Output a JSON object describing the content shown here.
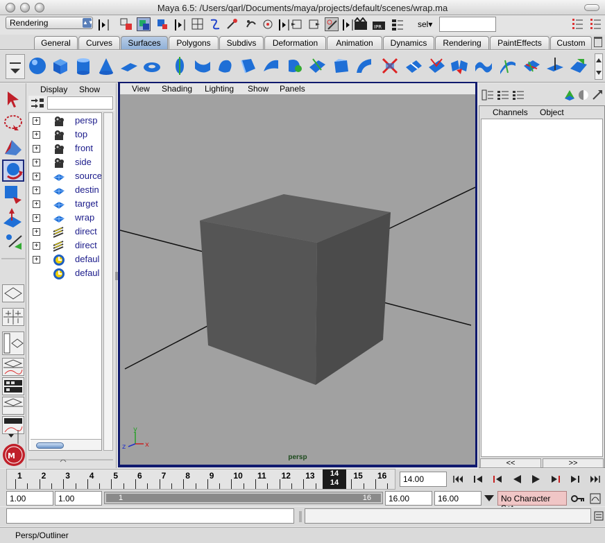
{
  "window": {
    "title": "Maya 6.5: /Users/qarl/Documents/maya/projects/default/scenes/wrap.ma"
  },
  "statusline": {
    "menu_set": "Rendering",
    "selection_label": "sel",
    "selection_value": ""
  },
  "shelf": {
    "tabs": [
      "General",
      "Curves",
      "Surfaces",
      "Polygons",
      "Subdivs",
      "Deformation",
      "Animation",
      "Dynamics",
      "Rendering",
      "PaintEffects",
      "Custom"
    ],
    "active_tab": "Surfaces"
  },
  "outliner": {
    "menu": [
      "Display",
      "Show"
    ],
    "items": [
      {
        "label": "persp",
        "icon": "camera-icon",
        "expandable": true
      },
      {
        "label": "top",
        "icon": "camera-icon",
        "expandable": true
      },
      {
        "label": "front",
        "icon": "camera-icon",
        "expandable": true
      },
      {
        "label": "side",
        "icon": "camera-icon",
        "expandable": true
      },
      {
        "label": "source",
        "icon": "nurbs-surface-icon",
        "expandable": true
      },
      {
        "label": "destin",
        "icon": "nurbs-surface-icon",
        "expandable": true
      },
      {
        "label": "target",
        "icon": "nurbs-surface-icon",
        "expandable": true
      },
      {
        "label": "wrap",
        "icon": "nurbs-surface-icon",
        "expandable": true
      },
      {
        "label": "direct",
        "icon": "directional-light-icon",
        "expandable": true
      },
      {
        "label": "direct",
        "icon": "directional-light-icon",
        "expandable": true
      },
      {
        "label": "defaul",
        "icon": "set-icon",
        "expandable": true
      },
      {
        "label": "defaul",
        "icon": "set-icon",
        "expandable": false
      }
    ]
  },
  "viewport": {
    "menu": [
      "View",
      "Shading",
      "Lighting",
      "Show",
      "Panels"
    ],
    "camera": "persp",
    "axis_labels": {
      "x": "x",
      "y": "y",
      "z": "z"
    }
  },
  "channel_box": {
    "tabs": [
      "Channels",
      "Object"
    ],
    "prev_label": "<<",
    "next_label": ">>"
  },
  "timeline": {
    "ticks": [
      "1",
      "2",
      "3",
      "4",
      "5",
      "6",
      "7",
      "8",
      "9",
      "10",
      "11",
      "12",
      "13",
      "14",
      "15",
      "16"
    ],
    "current_frame": "14",
    "current_frame_field": "14.00"
  },
  "range": {
    "start_time": "1.00",
    "playback_start": "1.00",
    "slider_start": "1",
    "slider_end": "16",
    "playback_end": "16.00",
    "end_time": "16.00",
    "character_set": "No Character Set"
  },
  "help_line": {
    "text": "Persp/Outliner"
  },
  "colors": {
    "viewport_bg": "#a1a1a1",
    "panel_focus": "#101a6e",
    "active_tab": "#8fb0d8",
    "outliner_text": "#1a1a8a",
    "character_set_bg": "#f0c6c6"
  }
}
